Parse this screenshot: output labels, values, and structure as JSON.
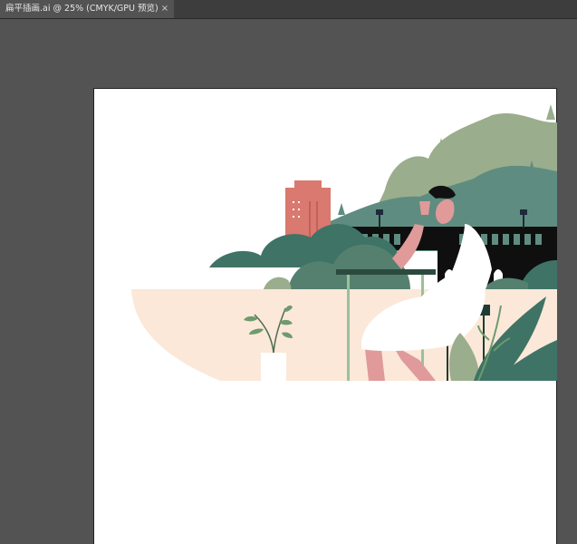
{
  "document_tab": {
    "title": "扁平插画.ai @ 25% (CMYK/GPU 预览)",
    "close_glyph": "×"
  },
  "colors": {
    "workspace": "#535353",
    "tabbar": "#3d3d3d",
    "artboard": "#ffffff",
    "sky_hill_light": "#9aad8c",
    "hill_dark": "#5f8c80",
    "bush_dark": "#3f7366",
    "bush_mid": "#55806f",
    "building": "#d9796f",
    "ground": "#fbe8d9",
    "skin": "#e09a9a",
    "dress": "#ffffff",
    "hair": "#111111",
    "table": "#2b4a3f",
    "bridge": "#0f0f0f",
    "plant_green": "#6f9a6e"
  },
  "artwork": {
    "icons": [
      "building",
      "bridge",
      "trees",
      "woman-with-drink",
      "cafe-table",
      "potted-plant",
      "leaves"
    ]
  }
}
